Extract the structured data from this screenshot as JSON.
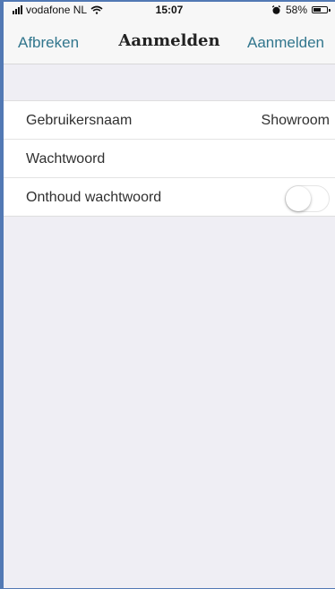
{
  "status_bar": {
    "carrier": "vodafone NL",
    "time": "15:07",
    "battery_percent": "58%",
    "battery_level": 0.58,
    "icons": [
      "signal-icon",
      "wifi-icon",
      "alarm-icon",
      "battery-icon"
    ]
  },
  "nav": {
    "cancel_label": "Afbreken",
    "title": "Aanmelden",
    "submit_label": "Aanmelden"
  },
  "form": {
    "username_label": "Gebruikersnaam",
    "username_value": "Showroom",
    "password_label": "Wachtwoord",
    "password_value": "",
    "remember_label": "Onthoud wachtwoord",
    "remember_enabled": false
  },
  "colors": {
    "accent": "#31768d",
    "background": "#efeef4",
    "frame_border": "#5279b4"
  }
}
